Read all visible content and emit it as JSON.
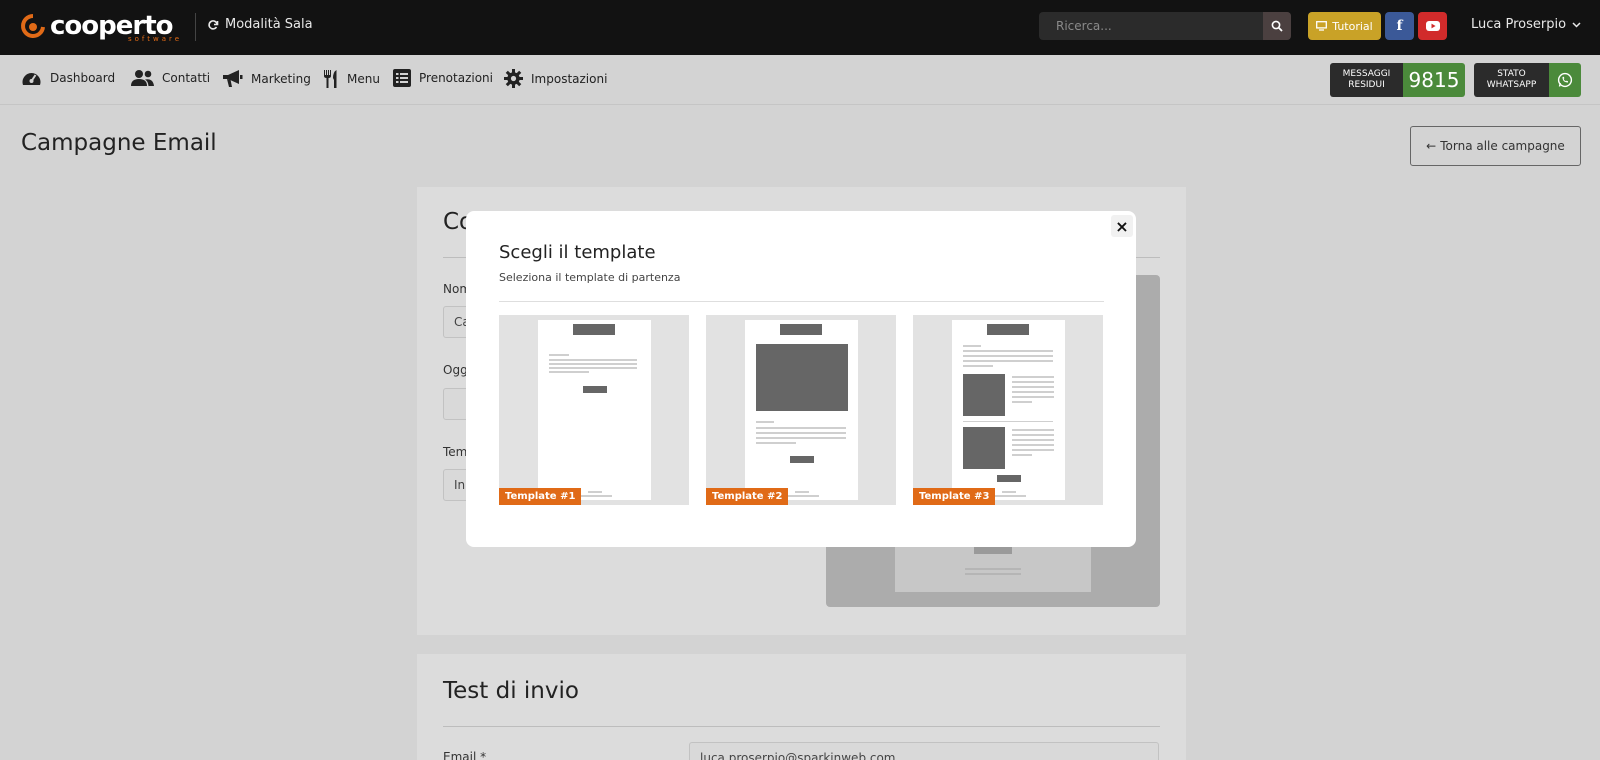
{
  "header": {
    "logo_text": "cooperto",
    "logo_sub": "software",
    "mode_label": "Modalità Sala",
    "search_placeholder": "Ricerca...",
    "tutorial_label": "Tutorial",
    "user_name": "Luca Proserpio"
  },
  "nav": {
    "items": [
      {
        "label": "Dashboard",
        "icon": "dashboard-icon"
      },
      {
        "label": "Contatti",
        "icon": "users-icon"
      },
      {
        "label": "Marketing",
        "icon": "megaphone-icon"
      },
      {
        "label": "Menu",
        "icon": "utensils-icon"
      },
      {
        "label": "Prenotazioni",
        "icon": "list-icon"
      },
      {
        "label": "Impostazioni",
        "icon": "gear-icon"
      }
    ],
    "messages_label_1": "MESSAGGI",
    "messages_label_2": "RESIDUI",
    "messages_count": "9815",
    "whatsapp_label_1": "STATO",
    "whatsapp_label_2": "WHATSAPP"
  },
  "page": {
    "title": "Campagne Email",
    "back_button": "Torna alle campagne"
  },
  "form": {
    "card_title": "Co",
    "name_label": "Nom",
    "name_value": "Ca",
    "subject_label": "Ogg",
    "template_label": "Tem",
    "template_value": "In"
  },
  "test": {
    "title": "Test di invio",
    "email_label": "Email *",
    "email_value": "luca.proserpio@sparkinweb.com"
  },
  "modal": {
    "title": "Scegli il template",
    "subtitle": "Seleziona il template di partenza",
    "close_symbol": "×",
    "templates": [
      {
        "label": "Template #1"
      },
      {
        "label": "Template #2"
      },
      {
        "label": "Template #3"
      }
    ]
  },
  "colors": {
    "topbar": "#121212",
    "accent_orange": "#e06a17",
    "tutorial_gold": "#c9a227",
    "facebook": "#3b5998",
    "youtube": "#d12b2b",
    "whatsapp_green": "#4b8a3b"
  }
}
